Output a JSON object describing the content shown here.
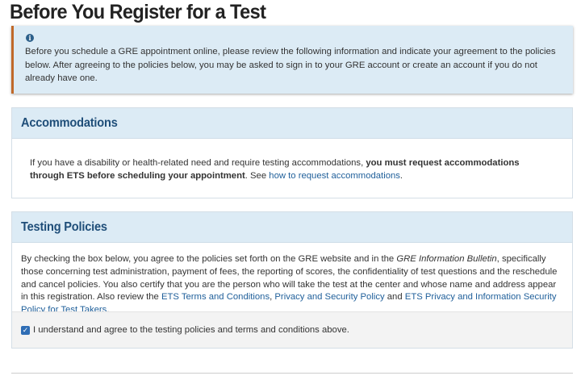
{
  "page": {
    "title": "Before You Register for a Test"
  },
  "info": {
    "icon": "info-icon",
    "text": "Before you schedule a GRE appointment online, please review the following information and indicate your agreement to the policies below. After agreeing to the policies below, you may be asked to sign in to your GRE account or create an account if you do not already have one."
  },
  "accommodations": {
    "title": "Accommodations",
    "text_before": "If you have a disability or health-related need and require testing accommodations, ",
    "bold_text": "you must request accommodations through ETS before scheduling your appointment",
    "text_after": ". See ",
    "link_label": "how to request accommodations",
    "text_end": "."
  },
  "policies": {
    "title": "Testing Policies",
    "text_1": "By checking the box below, you agree to the policies set forth on the GRE website and in the ",
    "italic_text": "GRE Information Bulletin",
    "text_2": ", specifically those concerning test administration, payment of fees, the reporting of scores, the confidentiality of test questions and the reschedule and cancel policies. You also certify that you are the person who will take the test at the center and whose name and address appear in this registration. Also review the ",
    "link_terms": "ETS Terms and Conditions",
    "sep_1": ", ",
    "link_privacy": "Privacy and Security Policy",
    "sep_2": " and ",
    "link_info_security": "ETS Privacy and Information Security Policy for Test Takers",
    "text_end": ".",
    "agree_label": "I understand and agree to the testing policies and terms and conditions above.",
    "agree_checked": true
  },
  "colors": {
    "header_bg": "#dcebf5",
    "accent_border": "#c0692a",
    "link": "#1f5f9a",
    "panel_title": "#1f4e79",
    "checkbox": "#2f6db5"
  }
}
